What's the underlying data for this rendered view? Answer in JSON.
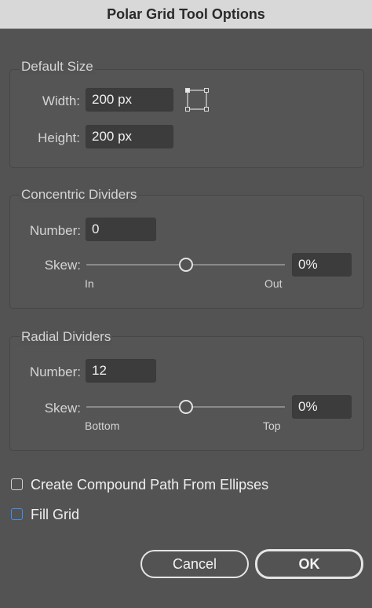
{
  "window": {
    "title": "Polar Grid Tool Options"
  },
  "default_size": {
    "title": "Default Size",
    "width_label": "Width:",
    "width_value": "200 px",
    "height_label": "Height:",
    "height_value": "200 px"
  },
  "concentric": {
    "title": "Concentric Dividers",
    "number_label": "Number:",
    "number_value": "0",
    "skew_label": "Skew:",
    "skew_value": "0%",
    "skew_min": "In",
    "skew_max": "Out",
    "skew_level": 0.5
  },
  "radial": {
    "title": "Radial Dividers",
    "number_label": "Number:",
    "number_value": "12",
    "skew_label": "Skew:",
    "skew_value": "0%",
    "skew_min": "Bottom",
    "skew_max": "Top",
    "skew_level": 0.5
  },
  "options": {
    "compound_label": "Create Compound Path From Ellipses",
    "compound_checked": false,
    "fill_label": "Fill Grid",
    "fill_checked": false
  },
  "buttons": {
    "cancel": "Cancel",
    "ok": "OK"
  },
  "icons": {
    "constrain": "constrain-proportions-icon"
  }
}
